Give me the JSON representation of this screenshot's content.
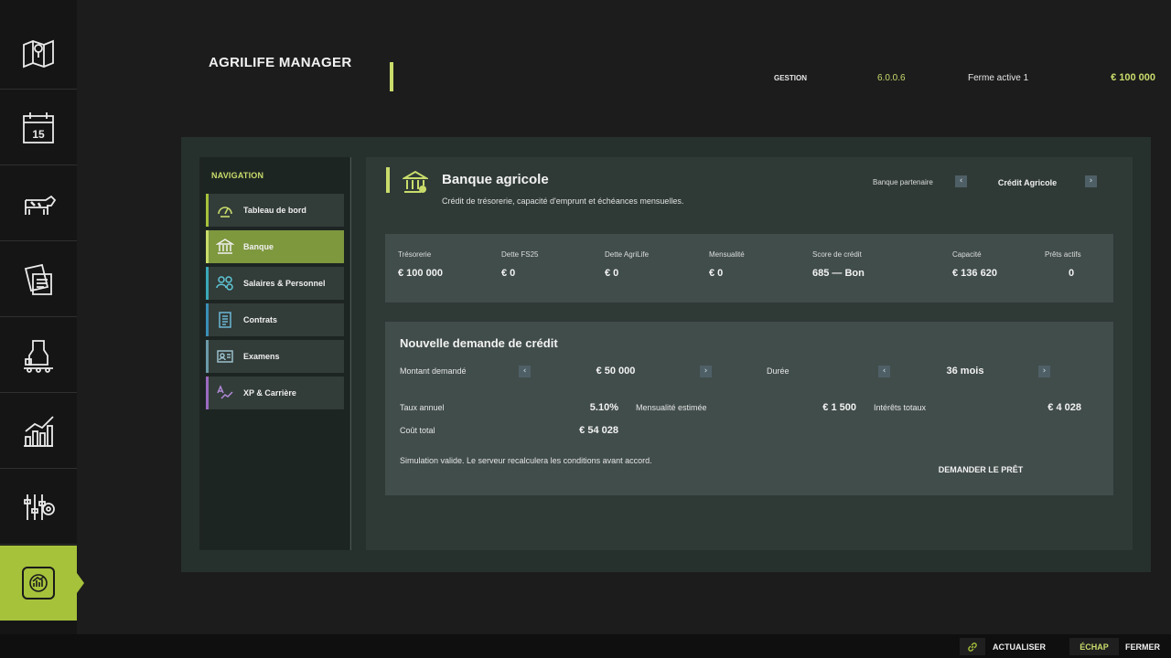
{
  "app": {
    "title": "AGRILIFE MANAGER"
  },
  "header": {
    "section": "GESTION",
    "version": "6.0.0.6",
    "farm": "Ferme active 1",
    "money": "€ 100 000"
  },
  "rail": {
    "items": [
      "map-icon",
      "calendar-icon",
      "cow-icon",
      "contracts-icon",
      "production-icon",
      "statistics-icon",
      "settings-icon",
      "agrilife-icon"
    ],
    "calendar_day": "15",
    "active_index": 7
  },
  "navigation": {
    "title": "NAVIGATION",
    "items": [
      {
        "label": "Tableau de bord",
        "icon": "gauge-icon",
        "accent": "#a6c23b"
      },
      {
        "label": "Banque",
        "icon": "bank-icon",
        "accent": "#c9dc6b"
      },
      {
        "label": "Salaires & Personnel",
        "icon": "people-icon",
        "accent": "#3aa8b8"
      },
      {
        "label": "Contrats",
        "icon": "contract-icon",
        "accent": "#3a8fb8"
      },
      {
        "label": "Examens",
        "icon": "exam-icon",
        "accent": "#6a9aa8"
      },
      {
        "label": "XP & Carrière",
        "icon": "xp-icon",
        "accent": "#9a6ac0"
      }
    ],
    "active_index": 1
  },
  "bank": {
    "title": "Banque agricole",
    "subtitle": "Crédit de trésorerie, capacité d'emprunt et échéances mensuelles.",
    "partner_label": "Banque partenaire",
    "partner_value": "Crédit Agricole"
  },
  "stats": [
    {
      "label": "Trésorerie",
      "value": "€ 100 000"
    },
    {
      "label": "Dette FS25",
      "value": "€ 0"
    },
    {
      "label": "Dette AgriLife",
      "value": "€ 0"
    },
    {
      "label": "Mensualité",
      "value": "€ 0"
    },
    {
      "label": "Score de crédit",
      "value": "685 — Bon"
    },
    {
      "label": "Capacité",
      "value": "€ 136 620"
    },
    {
      "label": "Prêts actifs",
      "value": "0"
    }
  ],
  "loan": {
    "title": "Nouvelle demande de crédit",
    "amount_label": "Montant demandé",
    "amount_value": "€ 50 000",
    "duration_label": "Durée",
    "duration_value": "36 mois",
    "rate_label": "Taux annuel",
    "rate_value": "5.10%",
    "monthly_label": "Mensualité estimée",
    "monthly_value": "€ 1 500",
    "interest_label": "Intérêts totaux",
    "interest_value": "€ 4 028",
    "total_label": "Coût total",
    "total_value": "€ 54 028",
    "note": "Simulation valide. Le serveur recalculera les conditions avant accord.",
    "request_button": "DEMANDER LE PRÊT"
  },
  "footer": {
    "refresh_label": "ACTUALISER",
    "esc_key": "ÉCHAP",
    "close_label": "FERMER"
  },
  "colors": {
    "accent": "#c9dc6b",
    "active_green": "#a6c23b",
    "panel": "#26302d",
    "card": "#414d4b"
  }
}
